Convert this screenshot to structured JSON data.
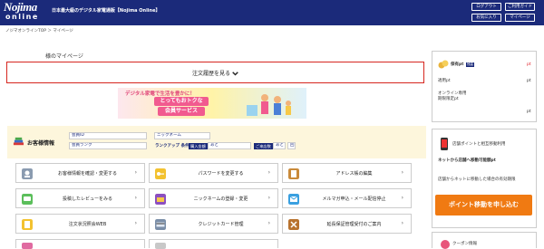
{
  "header": {
    "logo_line1": "Nojima",
    "logo_line2": "online",
    "tagline": "日本最大級のデジタル家電通販【Nojima Online】",
    "buttons": [
      "ログアウト",
      "ご利用ガイド",
      "お気に入り",
      "マイページ"
    ]
  },
  "breadcrumb": "ノジマオンラインTOP ＞ マイページ",
  "page_title": "様のマイページ",
  "order_history": {
    "label": "注文履歴を見る",
    "chevron": "chevron-down-icon"
  },
  "banner": {
    "line1": "デジタル家電で生活を豊かに！",
    "line2": "とってもおトクな",
    "line3": "会員サービス"
  },
  "member": {
    "title": "お客様情報",
    "id_label": "会員ID",
    "nickname_label": "ニックネーム",
    "rank_label": "会員ランク",
    "rankup_label": "ランクアップ 条件",
    "purchase_tag": "購入金額",
    "remain1": "あと",
    "visits_tag": "ご来店数",
    "remain2": "あと",
    "times": "回"
  },
  "menu": [
    {
      "label": "お客様情報を確認・変更する",
      "icon": "profile-icon"
    },
    {
      "label": "パスワードを変更する",
      "icon": "key-icon"
    },
    {
      "label": "アドレス帳の編集",
      "icon": "address-book-icon"
    },
    {
      "label": "投稿したレビューをみる",
      "icon": "review-icon"
    },
    {
      "label": "ニックネームの登録・変更",
      "icon": "folder-icon"
    },
    {
      "label": "メルマガ申込・メール配信停止",
      "icon": "mail-icon"
    },
    {
      "label": "注文状況照会WEB",
      "icon": "document-icon"
    },
    {
      "label": "クレジットカード管理",
      "icon": "credit-card-icon"
    },
    {
      "label": "延長保証管理受付のご案内",
      "icon": "tools-icon"
    }
  ],
  "side_points": {
    "title": "保有pt",
    "badge": "残高",
    "unit": "pt",
    "available_label": "適用pt",
    "online_label": "オンライン専用",
    "expire_label": "期限限定pt"
  },
  "side_transfer": {
    "title": "店舗ポイントと相互移動利用",
    "sub1": "ネットから店舗へ移動可能額pt",
    "sub2": "店舗からネットに移動した場合の有効期限",
    "button": "ポイント移動を申し込む"
  },
  "side_coupon": {
    "title": "クーポン情報"
  },
  "colors": {
    "header": "#1b2a7a",
    "accent_red": "#d6261f",
    "orange": "#f07a12",
    "member_bg": "#fdf6dc"
  }
}
